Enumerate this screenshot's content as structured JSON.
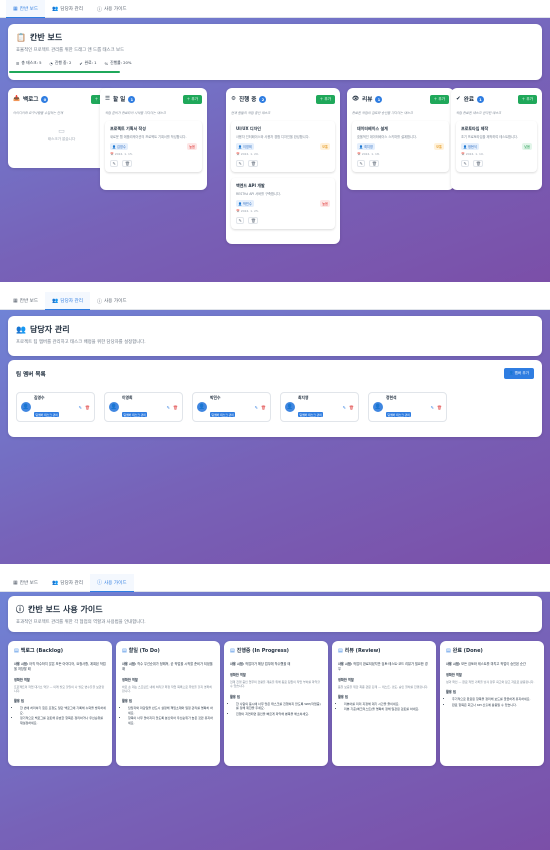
{
  "tabs": [
    {
      "label": "칸반 보드",
      "icon": "board-icon"
    },
    {
      "label": "담당자 관리",
      "icon": "users-icon"
    },
    {
      "label": "사용 가이드",
      "icon": "info-icon"
    }
  ],
  "board": {
    "title": "칸반 보드",
    "subtitle": "효율적인 프로젝트 관리를 위한 드래그 앤 드롭 태스크 보드",
    "stats": [
      {
        "label": "총 태스크: 5",
        "icon": "list-icon"
      },
      {
        "label": "진행 중: 2",
        "icon": "spinner-icon"
      },
      {
        "label": "완료: 1",
        "icon": "check-icon"
      },
      {
        "label": "진행률: 20%",
        "icon": "percent-icon"
      }
    ],
    "progress_percent": 20,
    "add_label": "추가",
    "empty_label": "태스크가 없습니다",
    "columns": [
      {
        "title": "백로그",
        "count": "0",
        "desc": "아이디어와 요구사항을 수집하는 단계",
        "tasks": []
      },
      {
        "title": "할 일",
        "count": "1",
        "desc": "작업 준비가 완료되어 시작을 기다리는 태스크",
        "tasks": [
          {
            "title": "프로젝트 기획서 작성",
            "desc": "새로운 웹 애플리케이션의 프로젝트 기획서를 작성합니다.",
            "assignee": "김영수",
            "priority": "높음",
            "level": "high",
            "date": "2024. 1. 15."
          }
        ]
      },
      {
        "title": "진행 중",
        "count": "2",
        "desc": "현재 활발히 작업 중인 태스크",
        "tasks": [
          {
            "title": "UI/UX 디자인",
            "desc": "사용자 인터페이스와 사용자 경험 디자인을 완성합니다.",
            "assignee": "이영희",
            "priority": "보통",
            "level": "mid",
            "date": "2024. 1. 20."
          },
          {
            "title": "백엔드 API 개발",
            "desc": "RESTful API 서버를 구축합니다.",
            "assignee": "박민수",
            "priority": "높음",
            "level": "high",
            "date": "2024. 1. 25."
          }
        ]
      },
      {
        "title": "리뷰",
        "count": "1",
        "desc": "완료된 작업의 검토와 승인을 기다리는 태스크",
        "tasks": [
          {
            "title": "데이터베이스 설계",
            "desc": "효율적인 데이터베이스 스키마를 설계합니다.",
            "assignee": "최지영",
            "priority": "보통",
            "level": "mid",
            "date": "2024. 1. 18."
          }
        ]
      },
      {
        "title": "완료",
        "count": "1",
        "desc": "작업 완료된 태스크 관리된 태스크",
        "tasks": [
          {
            "title": "프로토타입 제작",
            "desc": "초기 프로토타입을 제작하여 테스트합니다.",
            "assignee": "정현석",
            "priority": "낮음",
            "level": "low",
            "date": "2024. 1. 10."
          }
        ]
      }
    ]
  },
  "members": {
    "title": "담당자 관리",
    "subtitle": "프로젝트 팀 멤버를 관리하고 태스크 배정을 위한 담당자를 설정합니다.",
    "list_title": "팀 멤버 목록",
    "add_label": "멤버 추가",
    "items": [
      {
        "name": "김영수",
        "role": "팀멤버 태스크 관리"
      },
      {
        "name": "이영희",
        "role": "팀멤버 태스크 관리"
      },
      {
        "name": "박민수",
        "role": "팀멤버 태스크 관리"
      },
      {
        "name": "최지영",
        "role": "팀멤버 태스크 관리"
      },
      {
        "name": "정현석",
        "role": "팀멤버 태스크 관리"
      }
    ]
  },
  "guide": {
    "title": "칸반 보드 사용 가이드",
    "subtitle": "효과적인 프로젝트 관리를 위한 각 협업의 역할과 사용법을 안내합니다.",
    "usage_prefix": "사용 시점:",
    "method_label": "정확한 역할",
    "tips_label": "활용 팁",
    "cards": [
      {
        "title": "백로그 (Backlog)",
        "usage": "아직 착수하지 않은 모든 아이디어, 요청사항, 계획된 작업을 저장할 때",
        "method": "프로젝트의 작업 대기소 역할 — 미래 필요 할일이 나 필요 변수들을 보관합니다.",
        "tips": [
          "한 번에 처리하기 힘든 요청도 일단 백로그에 기록해 누락을 방지하세요.",
          "정기적으로 백로그를 검토해 유효한 항목은 정리하거나 우선순위를 재설정하세요."
        ]
      },
      {
        "title": "할일 (To Do)",
        "usage": "착수 우선순위가 정해져, 곧 작업을 시작할 준비가 되었을 때",
        "method": "바로 손 대는 스프린트 내에 처리할 확정 작업 목록으로 무엇을 할지 명확히 합니다.",
        "tips": [
          "담당자와 마감일을 반드시 설정해 책임소재와 일정 관리를 명확히 하세요.",
          "항목이 너무 많아지지 않도록 분산되어 우선순위가 높은 것만 유지하세요."
        ]
      },
      {
        "title": "진행중 (In Progress)",
        "usage": "작업자가 해당 업무에 착수했을 때",
        "method": "현재 진행 중인 업무의 현황을 계층을 위해 동료 팀원이 작업 부하를 파악할 수 있습니다.",
        "tips": [
          "한 사람의 동시에 너무 많은 태스크를 진행하지 않도록 WIP(작업중)를 정해 제한을 두세요.",
          "진행이 지연되면 원인을 빠르게 파악해 병목을 해소하세요."
        ]
      },
      {
        "title": "리뷰 (Review)",
        "usage": "작업이 완료되었지만 검토·테스트·코드 리뷰가 필요한 경우",
        "method": "품질 보증을 위한 최종 관문 단계 — 테스트, 검토, 승인 절차를 진행합니다.",
        "tips": [
          "리뷰어를 미리 지정해 대기 시간을 줄이세요.",
          "리뷰 기준(체크리스트)을 명확히 정해 일관된 검토를 하세요."
        ]
      },
      {
        "title": "완료 (Done)",
        "usage": "모든 검토와 테스트를 마치고 작업이 승인된 순간",
        "method": "성과 확인 — 완료 작업 기록을 남겨 향후 회고와 참고 자료로 활용합니다.",
        "tips": [
          "주기적으로 완료된 항목을 정리해 보드를 깔끔하게 유지하세요.",
          "완료 항목은 회고나 KPI 산출에 활용될 수 있습니다."
        ]
      }
    ]
  },
  "colors": {
    "accent": "#2f7de1",
    "success": "#1fa85a",
    "danger": "#dd3333",
    "bg_start": "#6f86d8",
    "bg_end": "#7b4fa8"
  }
}
